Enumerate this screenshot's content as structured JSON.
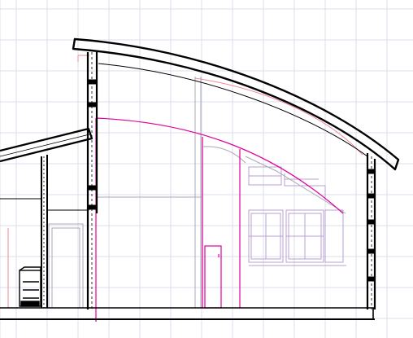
{
  "drawing": {
    "kind": "cad-building-section",
    "view": "section",
    "grid": true,
    "colors": {
      "background": "#ffffff",
      "grid": "#dcdcec",
      "linework": "#000000",
      "magenta": "#e0009a",
      "pink": "#f08a9a",
      "grey": "#a8a8b8",
      "lavender": "#b8a0d0"
    }
  }
}
